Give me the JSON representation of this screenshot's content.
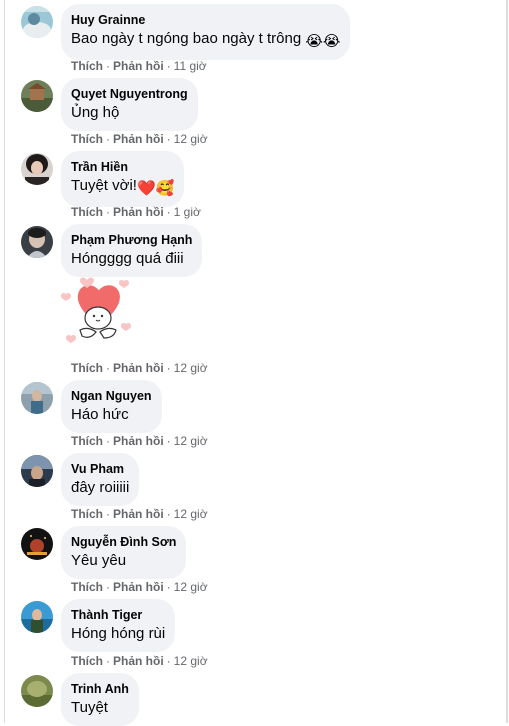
{
  "action_like": "Thích",
  "action_reply": "Phản hồi",
  "comments": [
    {
      "author": "Huy Grainne",
      "text": "Bao ngày t ngóng bao ngày t trông",
      "emoji": "😭😭",
      "time": "11 giờ"
    },
    {
      "author": "Quyet Nguyentrong",
      "text": "Ủng hộ",
      "emoji": "",
      "time": "12 giờ"
    },
    {
      "author": "Trần Hiền",
      "text": "Tuyệt vời!",
      "emoji": "❤️🥰",
      "time": "1 giờ"
    },
    {
      "author": "Phạm Phương Hạnh",
      "text": "Hóngggg quá điii",
      "emoji": "",
      "time": "12 giờ"
    },
    {
      "author": "Ngan Nguyen",
      "text": "Háo hức",
      "emoji": "",
      "time": "12 giờ"
    },
    {
      "author": "Vu Pham",
      "text": "đây roiiiii",
      "emoji": "",
      "time": "12 giờ"
    },
    {
      "author": "Nguyễn Đình Sơn",
      "text": "Yêu yêu",
      "emoji": "",
      "time": "12 giờ"
    },
    {
      "author": "Thành Tiger",
      "text": "Hóng hóng rùi",
      "emoji": "",
      "time": "12 giờ"
    },
    {
      "author": "Trinh Anh",
      "text": "Tuyệt",
      "emoji": "",
      "time": ""
    }
  ],
  "colors": {
    "bubble_bg": "#f0f2f5",
    "meta_text": "#65676b",
    "sticker_heart": "#f26b6b",
    "sticker_heart_light": "#f8c4c4"
  },
  "sticker_name": "heart-hug-sticker"
}
